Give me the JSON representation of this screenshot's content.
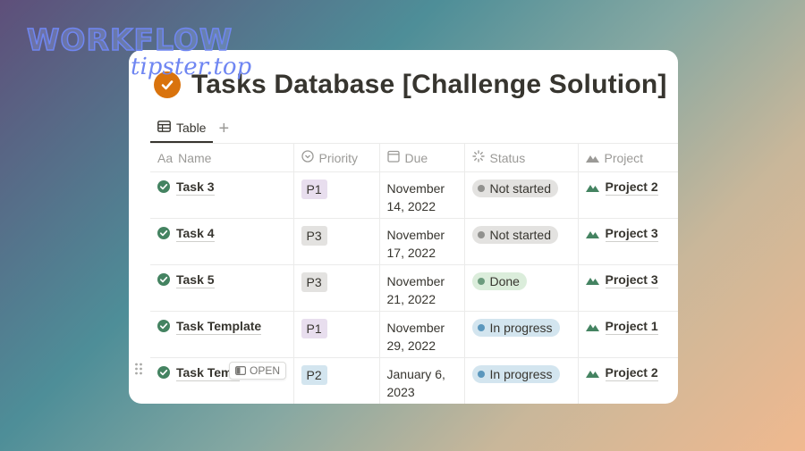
{
  "watermark": {
    "line1": "WORKFLOW",
    "line2": "tipster.top"
  },
  "page": {
    "title": "Tasks Database [Challenge Solution]"
  },
  "view": {
    "tab_label": "Table",
    "add_tab": "+"
  },
  "columns": {
    "name": "Name",
    "priority": "Priority",
    "due": "Due",
    "status": "Status",
    "project": "Project"
  },
  "column_icon_text": {
    "name": "Aa"
  },
  "open_label": "OPEN",
  "rows": [
    {
      "name": "Task 3",
      "priority": "P1",
      "due": "November\n14, 2022",
      "status": "Not started",
      "project": "Project 2"
    },
    {
      "name": "Task 4",
      "priority": "P3",
      "due": "November\n17, 2022",
      "status": "Not started",
      "project": "Project 3"
    },
    {
      "name": "Task 5",
      "priority": "P3",
      "due": "November\n21, 2022",
      "status": "Done",
      "project": "Project 3"
    },
    {
      "name": "Task Template",
      "priority": "P1",
      "due": "November\n29, 2022",
      "status": "In progress",
      "project": "Project 1"
    },
    {
      "name": "Task Temp",
      "priority": "P2",
      "due": "January 6,\n2023",
      "status": "In progress",
      "project": "Project 2"
    }
  ],
  "colors": {
    "title_icon": "#d9730d",
    "check_icon": "#448361",
    "project_icon": "#448361",
    "p1": "#e8deee",
    "p2": "#d3e5ef",
    "p3": "#e3e2e0",
    "not_started": "#e3e2e0",
    "done": "#dbeddb",
    "in_progress": "#d3e5ef"
  },
  "icons": {
    "title": "check-circle-icon",
    "tab": "table-icon",
    "priority": "select-icon",
    "due": "calendar-icon",
    "status": "status-icon",
    "project": "relation-mountain-icon",
    "row": "check-circle-icon",
    "drag": "drag-handle-icon"
  }
}
